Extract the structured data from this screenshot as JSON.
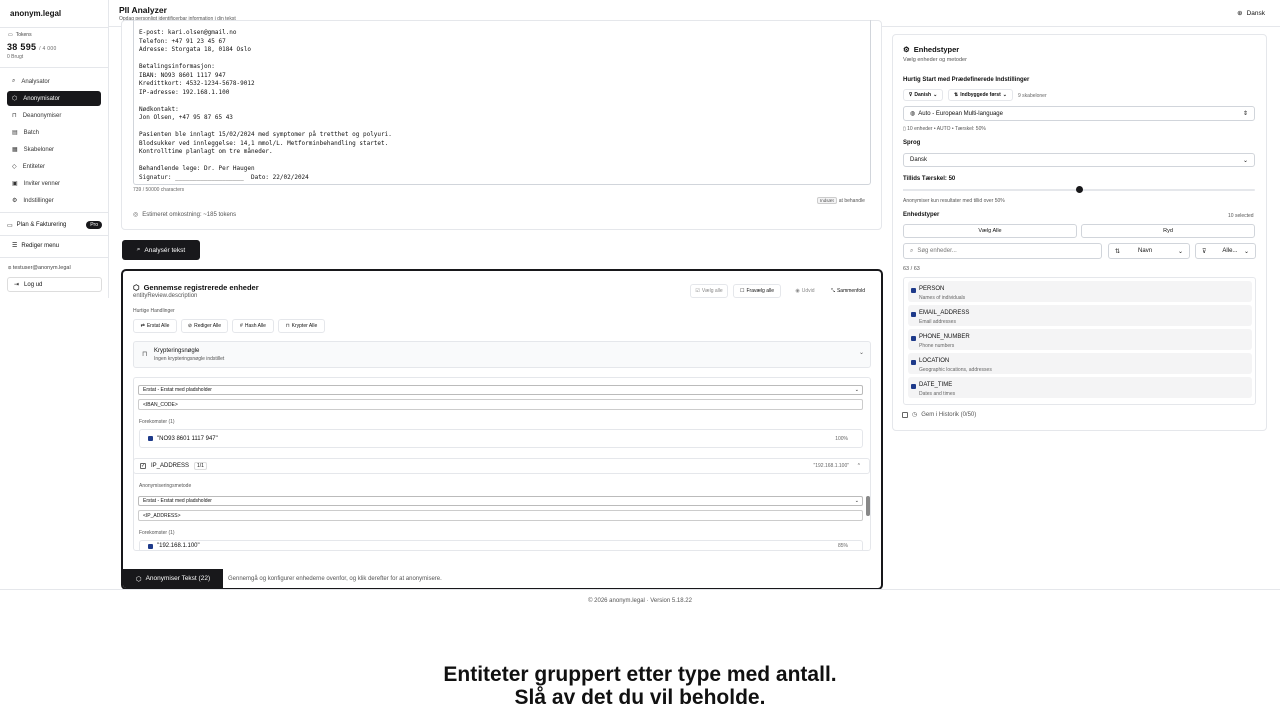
{
  "brand": "anonym.legal",
  "sidebar": {
    "tokens_label": "Tokens",
    "tokens_value": "38 595",
    "tokens_max": "/ 4 000",
    "tokens_used": "0 Brugt",
    "nav": [
      {
        "label": "Analysator"
      },
      {
        "label": "Anonymisator"
      },
      {
        "label": "Deanonymiser"
      },
      {
        "label": "Batch"
      },
      {
        "label": "Skabeloner"
      },
      {
        "label": "Entiteter"
      },
      {
        "label": "Inviter venner"
      },
      {
        "label": "Indstillinger"
      }
    ],
    "plan_label": "Plan & Fakturering",
    "plan_badge": "Pro",
    "edit_menu": "Rediger menu",
    "user_email": "testuser@anonym.legal",
    "logout": "Log ud"
  },
  "header": {
    "title": "PII Analyzer",
    "subtitle": "Opdag personligt identificerbar information i din tekst",
    "language": "Dansk"
  },
  "editor": {
    "text": "E-post: kari.olsen@gmail.no\nTelefon: +47 91 23 45 67\nAdresse: Storgata 18, 0184 Oslo\n\nBetalingsinformasjon:\nIBAN: NO93 8601 1117 947\nKredittkort: 4532-1234-5678-9012\nIP-adresse: 192.168.1.100\n\nNødkontakt:\nJon Olsen, +47 95 87 65 43\n\nPasienten ble innlagt 15/02/2024 med symptomer på tretthet og polyuri.\nBlodsukker ved innleggelse: 14,1 mmol/L. Metforminbehandling startet.\nKontrolltime planlagt om tre måneder.\n\nBehandlende lege: Dr. Per Haugen\nSignatur: ___________________  Dato: 22/02/2024",
    "char_count": "739 / 50000 characters",
    "hint_key": "Indsæt",
    "hint_text": "at behandle",
    "cost": "Estimeret omkostning: ~185 tokens",
    "analyse_button": "Analysér tekst"
  },
  "review": {
    "title": "Gennemse registrerede enheder",
    "description": "entityReview.description",
    "btn_select_all": "Vælg alle",
    "btn_deselect_all": "Fravælg alle",
    "btn_expand": "Udvid",
    "btn_collapse": "Sammenfold",
    "quick_label": "Hurtige Handlinger",
    "quick": [
      "Erstat Alle",
      "Rediger Alle",
      "Hash Alle",
      "Krypter Alle"
    ],
    "key_title": "Krypteringsnøgle",
    "key_sub": "Ingen krypteringsnøgle indstillet",
    "iban_method": "Erstat - Erstat med pladsholder",
    "iban_placeholder": "<IBAN_CODE>",
    "occ_label_1": "Forekomster (1)",
    "iban_occurrence": "\"NO93 8601 1117 947\"",
    "iban_conf": "100%",
    "ip_name": "IP_ADDRESS",
    "ip_count": "1/1",
    "ip_value": "\"192.168.1.100\"",
    "method_label": "Anonymiseringsmetode",
    "ip_method": "Erstat - Erstat med pladsholder",
    "ip_placeholder": "<IP_ADDRESS>",
    "occ_label_2": "Forekomster (1)",
    "ip_occurrence": "\"192.168.1.100\"",
    "ip_conf": "85%",
    "anon_button": "Anonymiser Tekst (22)",
    "anon_hint": "Gennemgå og konfigurer enhederne ovenfor, og klik derefter for at anonymisere."
  },
  "panel": {
    "title": "Enhedstyper",
    "subtitle": "Vælg enheder og metoder",
    "quickstart_label": "Hurtig Start med Prædefinerede Indstillinger",
    "chip_lang": "Danish",
    "chip_sort": "Indbyggede først",
    "chip_note": "9 skabeloner",
    "preset": "Auto - European Multi-language",
    "preset_meta": "10 enheder • AUTO • Tærskel: 50%",
    "lang_label": "Sprog",
    "lang_value": "Dansk",
    "threshold_label": "Tillids Tærskel: 50",
    "threshold_value": 50,
    "threshold_hint": "Anonymiser kun resultater med tillid over 50%",
    "entity_label": "Enhedstyper",
    "selected_count": "10 selected",
    "btn_select_all": "Vælg Alle",
    "btn_clear": "Ryd",
    "search_placeholder": "Søg enheder...",
    "sort_value": "Navn",
    "filter_value": "Alle...",
    "count": "63 / 63",
    "entities": [
      {
        "name": "PERSON",
        "desc": "Names of individuals"
      },
      {
        "name": "EMAIL_ADDRESS",
        "desc": "Email addresses"
      },
      {
        "name": "PHONE_NUMBER",
        "desc": "Phone numbers"
      },
      {
        "name": "LOCATION",
        "desc": "Geographic locations, addresses"
      },
      {
        "name": "DATE_TIME",
        "desc": "Dates and times"
      }
    ],
    "history": "Gem i Historik (0/50)"
  },
  "footer": "© 2026 anonym.legal · Version 5.18.22",
  "caption_line1": "Entiteter gruppert etter type med antall.",
  "caption_line2": "Slå av det du vil beholde."
}
